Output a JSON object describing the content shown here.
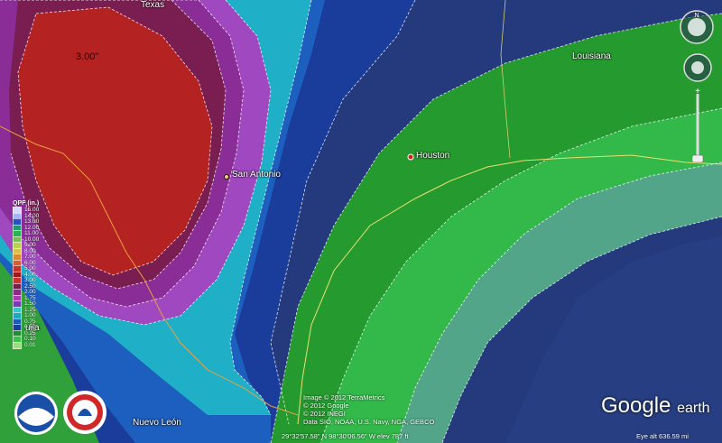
{
  "places": {
    "texas": "Texas",
    "louisiana": "Louisiana",
    "houston": "Houston",
    "san_antonio": "San Antonio",
    "nuevo_leon": "Nuevo León",
    "coahuila": "uila",
    "max_label": "3.00\""
  },
  "legend": {
    "title": "QPF (in.)",
    "items": [
      {
        "label": "15.00",
        "color": "#d8d8ff"
      },
      {
        "label": "14.00",
        "color": "#a0b4ff"
      },
      {
        "label": "13.00",
        "color": "#2a4fbf"
      },
      {
        "label": "12.00",
        "color": "#1e9c6a"
      },
      {
        "label": "11.00",
        "color": "#29b34f"
      },
      {
        "label": "10.00",
        "color": "#70c34f"
      },
      {
        "label": "9.00",
        "color": "#b9d24a"
      },
      {
        "label": "8.00",
        "color": "#d6c24a"
      },
      {
        "label": "7.00",
        "color": "#d88c2e"
      },
      {
        "label": "6.00",
        "color": "#d4602e"
      },
      {
        "label": "5.00",
        "color": "#c8302a"
      },
      {
        "label": "4.00",
        "color": "#a0181c"
      },
      {
        "label": "3.00",
        "color": "#d03030"
      },
      {
        "label": "2.50",
        "color": "#7c1a4a"
      },
      {
        "label": "2.00",
        "color": "#8c2a8c"
      },
      {
        "label": "1.75",
        "color": "#a83cb0"
      },
      {
        "label": "1.50",
        "color": "#7a3ab8"
      },
      {
        "label": "1.25",
        "color": "#2fc8d0"
      },
      {
        "label": "1.00",
        "color": "#20a8c0"
      },
      {
        "label": "0.75",
        "color": "#1a5ab8"
      },
      {
        "label": "0.50",
        "color": "#1a3e9c"
      },
      {
        "label": "0.25",
        "color": "#1e8c3a"
      },
      {
        "label": "0.10",
        "color": "#3cc04a"
      },
      {
        "label": "0.01",
        "color": "#9adc7a"
      }
    ]
  },
  "credits": {
    "line1": "Image © 2012 TerraMetrics",
    "line2": "© 2012 Google",
    "line3": "© 2012 INEGI",
    "line4": "Data SIO, NOAA, U.S. Navy, NGA, GEBCO"
  },
  "status": {
    "coords": "29°32'57.58\" N  98°30'06.56\" W  elev  787 ft",
    "eye_alt": "Eye alt  636.59 mi"
  },
  "branding": {
    "google": "Google",
    "earth": "earth"
  },
  "colors": {
    "qpf_3in": "#b52222",
    "qpf_2_5in": "#7a1e52",
    "qpf_2in": "#8a2d96",
    "qpf_1_5in": "#a048c0",
    "qpf_1_25in": "#22b4c8",
    "qpf_1in": "#1a9ec4",
    "qpf_0_75in": "#1d5fbf",
    "qpf_0_5in": "#1a3c9a",
    "qpf_0_25in": "#259a2e",
    "qpf_0_1in": "#33b84a",
    "qpf_0_01in": "#5cb88c",
    "gulf": "#243a7c"
  }
}
